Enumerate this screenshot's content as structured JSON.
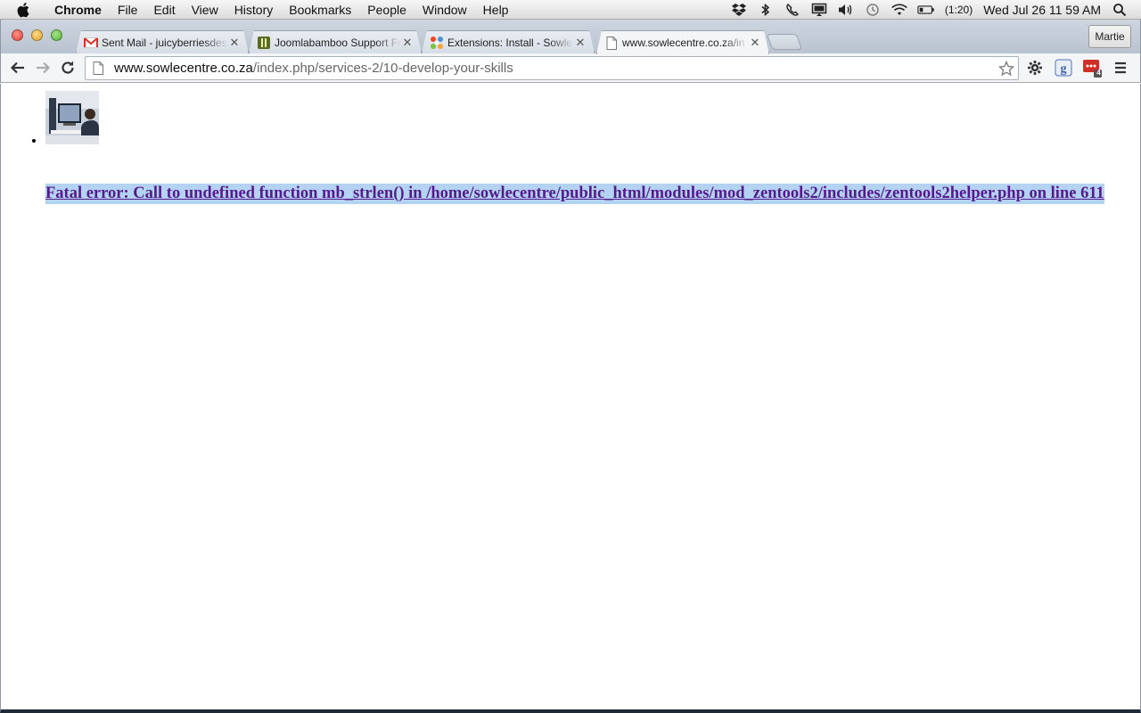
{
  "menubar": {
    "app_name": "Chrome",
    "items": [
      "File",
      "Edit",
      "View",
      "History",
      "Bookmarks",
      "People",
      "Window",
      "Help"
    ],
    "battery_time": "(1:20)",
    "clock": "Wed Jul 26  11 59 AM"
  },
  "tabs": [
    {
      "label": "Sent Mail - juicyberriesdes",
      "icon": "gmail-icon"
    },
    {
      "label": "Joomlabamboo Support Fo",
      "icon": "joomlabamboo-icon"
    },
    {
      "label": "Extensions: Install - Sowle",
      "icon": "joomla-icon"
    },
    {
      "label": "www.sowlecentre.co.za/in",
      "icon": "page-icon"
    }
  ],
  "profile_name": "Martie",
  "omnibox": {
    "host": "www.sowlecentre.co.za",
    "path": "/index.php/services-2/10-develop-your-skills"
  },
  "extension_badge": "4",
  "page": {
    "error_text": "Fatal error: Call to undefined function mb_strlen() in /home/sowlecentre/public_html/modules/mod_zentools2/includes/zentools2helper.php on line 611"
  },
  "colors": {
    "visited_link": "#551a8b",
    "selection": "#b4d3f2"
  }
}
